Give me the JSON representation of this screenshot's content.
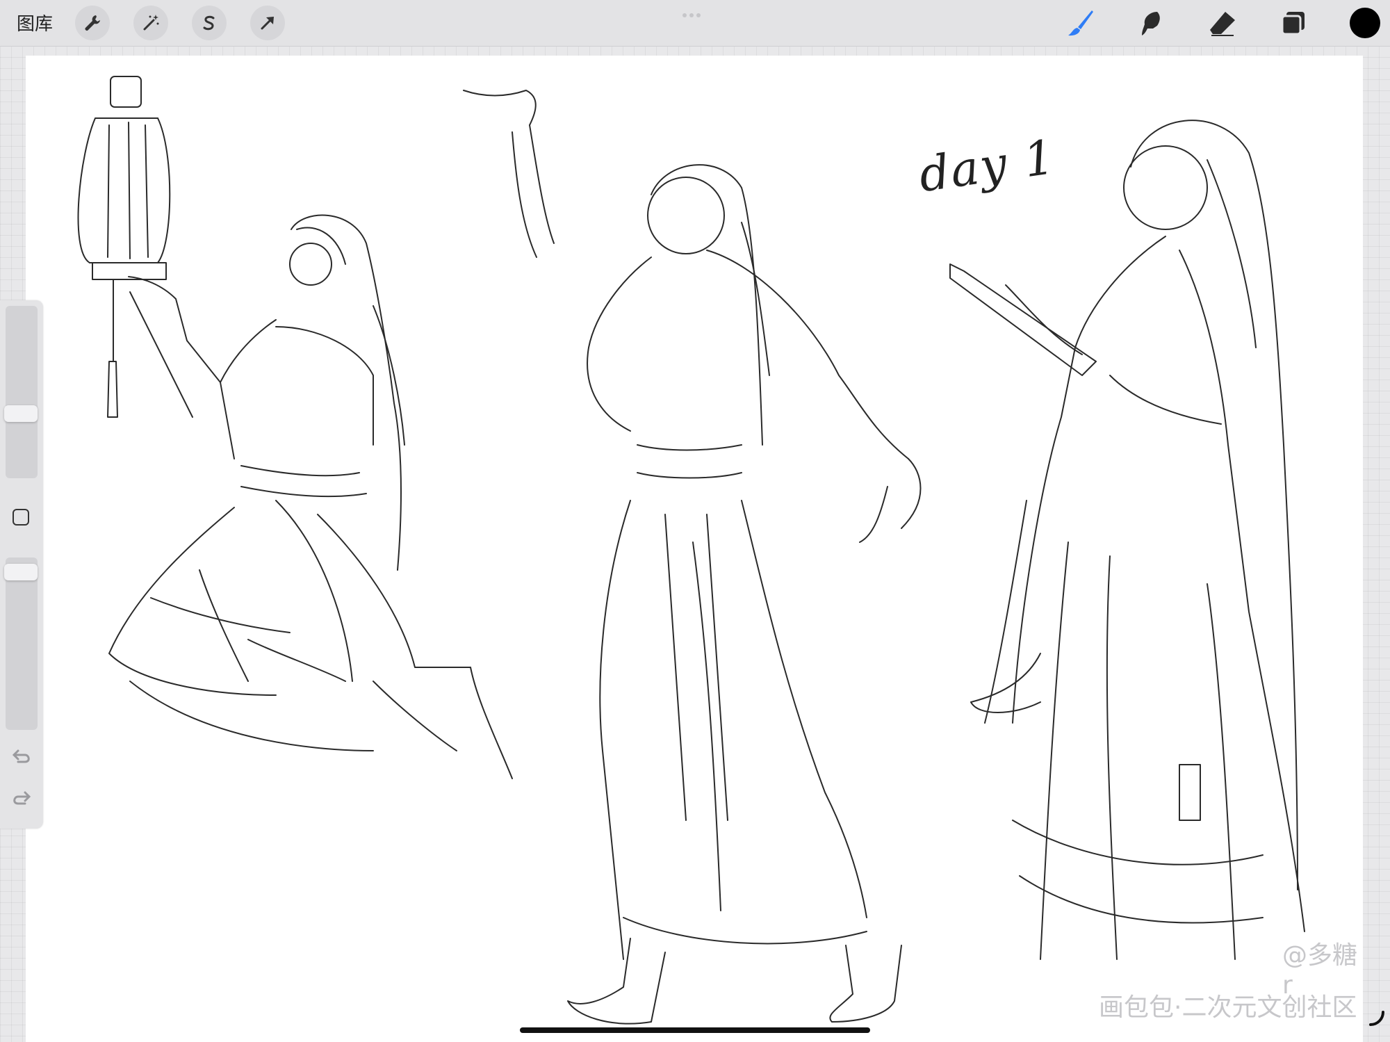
{
  "topbar": {
    "gallery_label": "图库",
    "left_tools": [
      "wrench-icon",
      "magic-wand-icon",
      "selection-s-icon",
      "transform-arrow-icon"
    ],
    "right_tools": [
      "brush-icon",
      "smudge-icon",
      "eraser-icon",
      "layers-icon"
    ],
    "active_tool": "brush",
    "current_color": "#000000",
    "accent_color": "#2f7df6"
  },
  "canvas": {
    "handwritten_label": "day 1",
    "watermark_user": "@多糖r",
    "watermark_site": "画包包·二次元文创社区"
  },
  "sidebar": {
    "brush_size_level": 0.36,
    "opacity_level": 0.96,
    "icons": [
      "modify-square-icon",
      "undo-icon",
      "redo-icon"
    ]
  }
}
